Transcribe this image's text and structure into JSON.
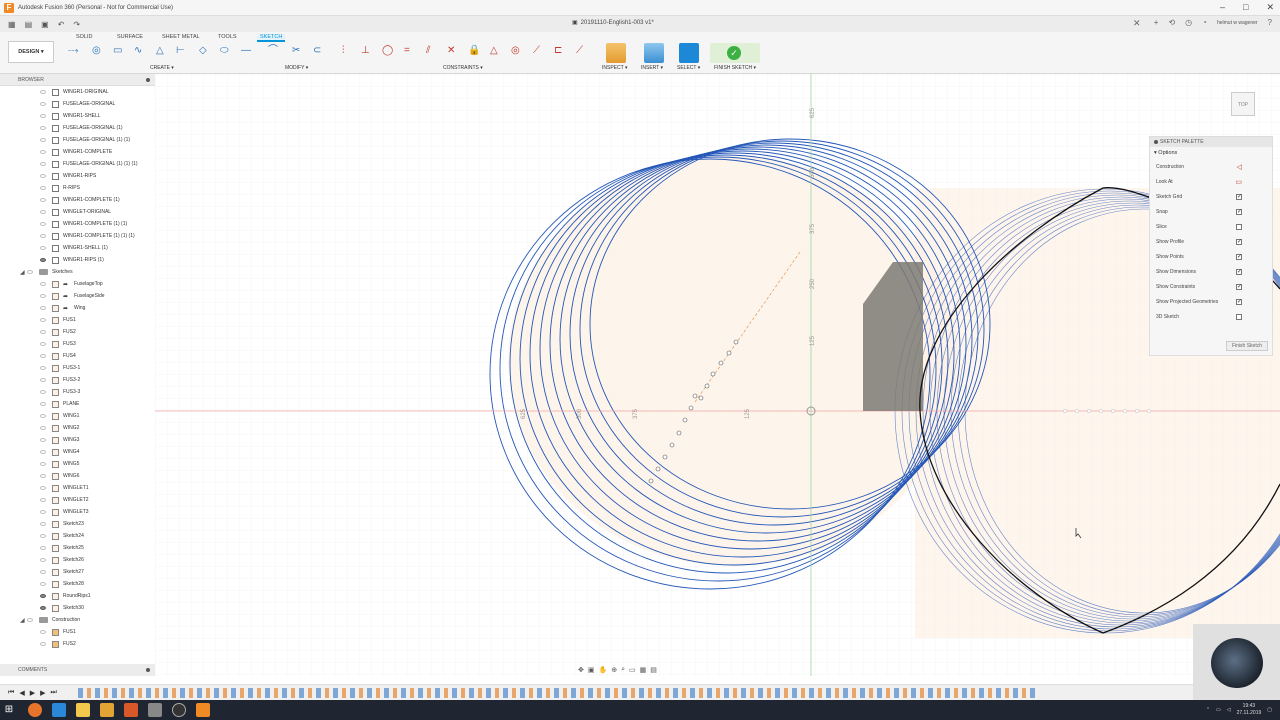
{
  "window": {
    "title": "Autodesk Fusion 360 (Personal - Not for Commercial Use)",
    "document_tab": "20191110-English1-003 v1*",
    "user_name": "helmut w wagener"
  },
  "ribbon": {
    "workspace": "DESIGN ▾",
    "tabs": [
      "SOLID",
      "SURFACE",
      "SHEET METAL",
      "TOOLS",
      "SKETCH"
    ],
    "active_tab": "SKETCH",
    "groups": {
      "create": "CREATE ▾",
      "modify": "MODIFY ▾",
      "constraints": "CONSTRAINTS ▾",
      "inspect": "INSPECT ▾",
      "insert": "INSERT ▾",
      "select": "SELECT ▾",
      "finish": "FINISH SKETCH ▾"
    }
  },
  "browser": {
    "title": "BROWSER",
    "items": [
      {
        "label": "WINGR1-ORIGINAL",
        "type": "body",
        "visible": false
      },
      {
        "label": "FUSELAGE-ORIGINAL",
        "type": "body",
        "visible": false
      },
      {
        "label": "WINGR1-SHELL",
        "type": "body",
        "visible": false
      },
      {
        "label": "FUSELAGE-ORIGINAL (1)",
        "type": "body",
        "visible": false
      },
      {
        "label": "FUSELAGE-ORIGINAL (1) (1)",
        "type": "body",
        "visible": false
      },
      {
        "label": "WINGR1-COMPLETE",
        "type": "body",
        "visible": false
      },
      {
        "label": "FUSELAGE-ORIGINAL (1) (1) (1)",
        "type": "body",
        "visible": false
      },
      {
        "label": "WINGR1-RIPS",
        "type": "body",
        "visible": false
      },
      {
        "label": "R-RIPS",
        "type": "body",
        "visible": false
      },
      {
        "label": "WINGR1-COMPLETE (1)",
        "type": "body",
        "visible": false
      },
      {
        "label": "WINGLET-ORIGINAL",
        "type": "body",
        "visible": false
      },
      {
        "label": "WINGR1-COMPLETE (1) (1)",
        "type": "body",
        "visible": false
      },
      {
        "label": "WINGR1-COMPLETE (1) (1) (1)",
        "type": "body",
        "visible": false
      },
      {
        "label": "WINGR1-SHELL (1)",
        "type": "body",
        "visible": false
      },
      {
        "label": "WINGR1-RIPS (1)",
        "type": "body",
        "visible": true
      },
      {
        "label": "Sketches",
        "type": "folder",
        "visible": false
      },
      {
        "label": "FuselageTop",
        "type": "sketch-link",
        "visible": false
      },
      {
        "label": "FuselageSide",
        "type": "sketch-link",
        "visible": false
      },
      {
        "label": "Wing",
        "type": "sketch-link",
        "visible": false
      },
      {
        "label": "FUS1",
        "type": "sketch",
        "visible": false
      },
      {
        "label": "FUS2",
        "type": "sketch",
        "visible": false
      },
      {
        "label": "FUS3",
        "type": "sketch",
        "visible": false
      },
      {
        "label": "FUS4",
        "type": "sketch",
        "visible": false
      },
      {
        "label": "FUS3-1",
        "type": "sketch",
        "visible": false
      },
      {
        "label": "FUS3-2",
        "type": "sketch",
        "visible": false
      },
      {
        "label": "FUS3-3",
        "type": "sketch",
        "visible": false
      },
      {
        "label": "PLANE",
        "type": "sketch",
        "visible": false
      },
      {
        "label": "WING1",
        "type": "sketch",
        "visible": false
      },
      {
        "label": "WING2",
        "type": "sketch",
        "visible": false
      },
      {
        "label": "WING3",
        "type": "sketch",
        "visible": false
      },
      {
        "label": "WING4",
        "type": "sketch",
        "visible": false
      },
      {
        "label": "WING5",
        "type": "sketch",
        "visible": false
      },
      {
        "label": "WING6",
        "type": "sketch",
        "visible": false
      },
      {
        "label": "WINGLET1",
        "type": "sketch",
        "visible": false
      },
      {
        "label": "WINGLET2",
        "type": "sketch",
        "visible": false
      },
      {
        "label": "WINGLET3",
        "type": "sketch",
        "visible": false
      },
      {
        "label": "Sketch23",
        "type": "sketch",
        "visible": false
      },
      {
        "label": "Sketch24",
        "type": "sketch",
        "visible": false
      },
      {
        "label": "Sketch25",
        "type": "sketch",
        "visible": false
      },
      {
        "label": "Sketch26",
        "type": "sketch",
        "visible": false
      },
      {
        "label": "Sketch27",
        "type": "sketch",
        "visible": false
      },
      {
        "label": "Sketch28",
        "type": "sketch",
        "visible": false
      },
      {
        "label": "RoundRips1",
        "type": "sketch",
        "visible": true
      },
      {
        "label": "Sketch30",
        "type": "sketch",
        "visible": true
      },
      {
        "label": "Construction",
        "type": "folder",
        "visible": false
      },
      {
        "label": "FUS1",
        "type": "plane",
        "visible": false
      },
      {
        "label": "FUS2",
        "type": "plane",
        "visible": false
      }
    ]
  },
  "comments": {
    "title": "COMMENTS"
  },
  "canvas": {
    "dimension_labels": [
      "625",
      "500",
      "375",
      "250",
      "125",
      "500",
      "375",
      "125",
      "625"
    ],
    "viewcube_label": "TOP"
  },
  "sketch_palette": {
    "title": "SKETCH PALETTE",
    "section": "Options",
    "options": [
      {
        "label": "Construction",
        "kind": "icon",
        "value": "◁"
      },
      {
        "label": "Look At",
        "kind": "icon",
        "value": "▭"
      },
      {
        "label": "Sketch Grid",
        "kind": "check",
        "value": "✓"
      },
      {
        "label": "Snap",
        "kind": "check",
        "value": "✓"
      },
      {
        "label": "Slice",
        "kind": "check",
        "value": ""
      },
      {
        "label": "Show Profile",
        "kind": "check",
        "value": "✓"
      },
      {
        "label": "Show Points",
        "kind": "check",
        "value": "✓"
      },
      {
        "label": "Show Dimensions",
        "kind": "check",
        "value": "✓"
      },
      {
        "label": "Show Constraints",
        "kind": "check",
        "value": "✓"
      },
      {
        "label": "Show Projected Geometries",
        "kind": "check",
        "value": "✓"
      },
      {
        "label": "3D Sketch",
        "kind": "check",
        "value": ""
      }
    ],
    "finish_label": "Finish Sketch"
  },
  "taskbar": {
    "time": "19:43",
    "date": "27.11.2019"
  },
  "colors": {
    "accent": "#0696d7",
    "sketch_curve": "#2457b8",
    "profile_fill": "#fdf1e6",
    "selected_region": "#7d7a74"
  }
}
